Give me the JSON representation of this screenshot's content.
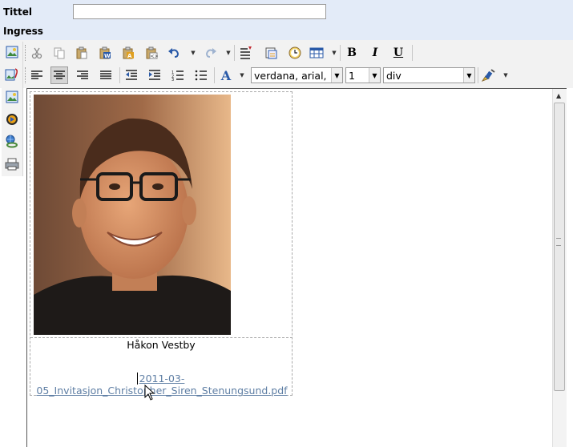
{
  "form": {
    "title_label": "Tittel",
    "title_value": "",
    "ingress_label": "Ingress"
  },
  "toolbar": {
    "bold_label": "B",
    "italic_label": "I",
    "underline_label": "U",
    "font_family_value": "verdana, arial,",
    "font_size_value": "1",
    "block_format_value": "div",
    "font_color_label": "A"
  },
  "sidebar": {
    "buttons": [
      "insert-image-icon",
      "insert-document-icon",
      "image-manager-icon",
      "insert-media-icon",
      "insert-link-icon",
      "print-icon"
    ]
  },
  "content": {
    "caption": "Håkon Vestby",
    "file_link_line1": "2011-03-",
    "file_link_line2": "05_Invitasjon_Christopher_Siren_Stenungsund.pdf"
  },
  "colors": {
    "top_bar_bg": "#e3ebf8",
    "toolbar_bg": "#f2f2f2",
    "link_color": "#5e7ea4"
  }
}
